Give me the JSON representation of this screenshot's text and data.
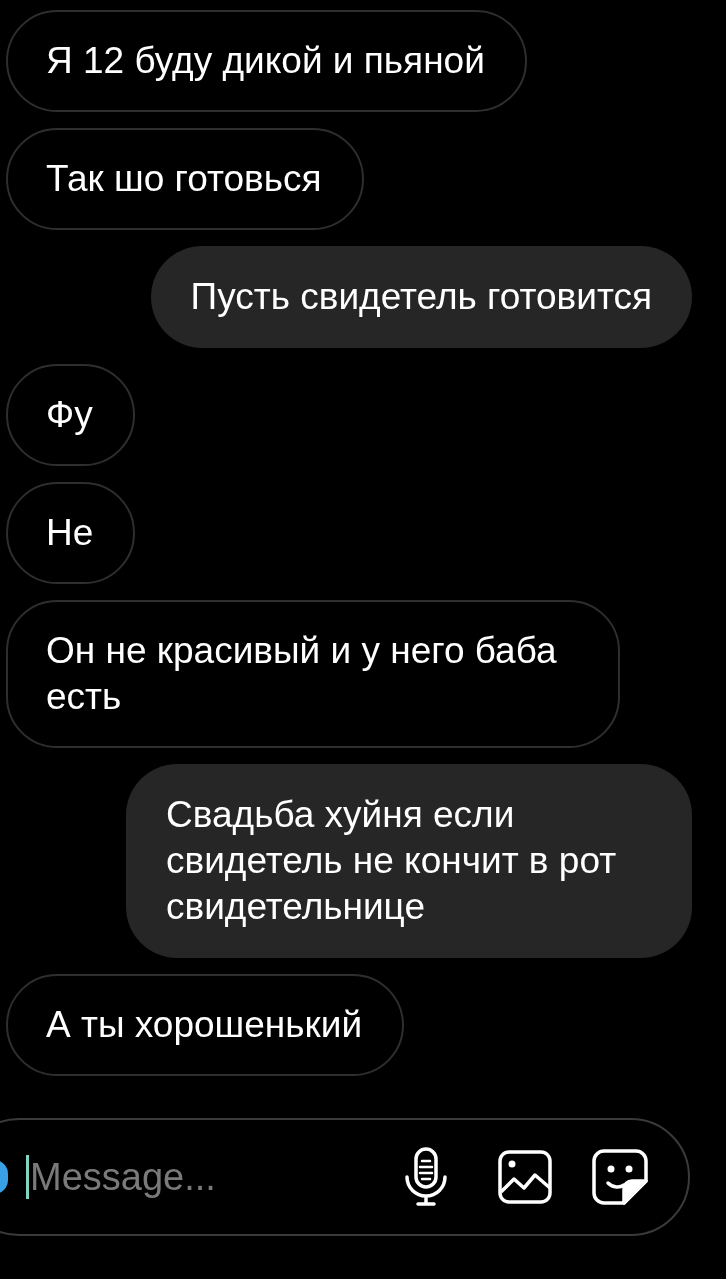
{
  "messages": [
    {
      "text": "Я 12 буду дикой и пьяной",
      "kind": "received"
    },
    {
      "text": "Так шо готовься",
      "kind": "received"
    },
    {
      "text": "Пусть свидетель готовится",
      "kind": "sent"
    },
    {
      "text": "Фу",
      "kind": "received"
    },
    {
      "text": "Не",
      "kind": "received"
    },
    {
      "text": "Он не красивый и у него баба есть",
      "kind": "received"
    },
    {
      "text": "Свадьба хуйня если свидетель не кончит в рот свидетельнице",
      "kind": "sent"
    },
    {
      "text": "А ты хорошенький",
      "kind": "received"
    }
  ],
  "composer": {
    "placeholder": "Message..."
  }
}
